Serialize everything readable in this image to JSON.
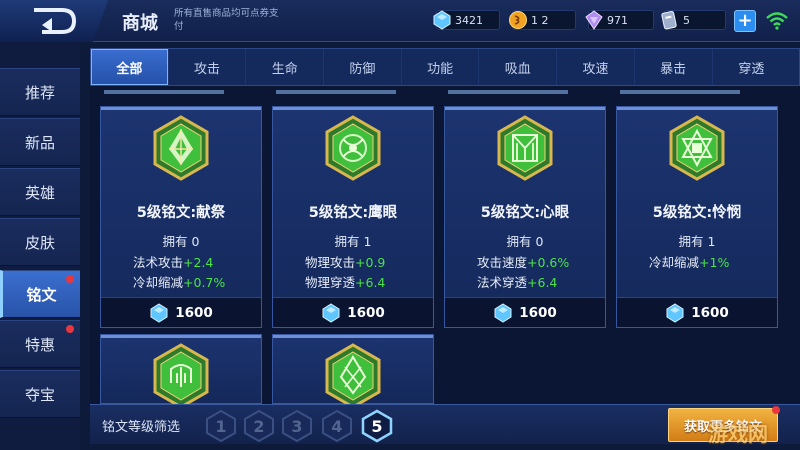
{
  "header": {
    "title": "商城",
    "subtitle": "所有直售商品均可点券支付",
    "currencies": [
      {
        "name": "diamond",
        "icon": "diamond-icon",
        "value": "3421"
      },
      {
        "name": "gold",
        "icon": "gold-coin-icon",
        "value": "1 2"
      },
      {
        "name": "crystal",
        "icon": "crystal-icon",
        "value": "971"
      },
      {
        "name": "voucher",
        "icon": "voucher-icon",
        "value": "5"
      }
    ]
  },
  "sidebar": {
    "items": [
      {
        "label": "推荐",
        "badge": false
      },
      {
        "label": "新品",
        "badge": false
      },
      {
        "label": "英雄",
        "badge": false
      },
      {
        "label": "皮肤",
        "badge": false
      },
      {
        "label": "铭文",
        "badge": true,
        "active": true
      },
      {
        "label": "特惠",
        "badge": true
      },
      {
        "label": "夺宝",
        "badge": false
      }
    ]
  },
  "tabs": [
    {
      "label": "全部",
      "active": true
    },
    {
      "label": "攻击"
    },
    {
      "label": "生命"
    },
    {
      "label": "防御"
    },
    {
      "label": "功能"
    },
    {
      "label": "吸血"
    },
    {
      "label": "攻速"
    },
    {
      "label": "暴击"
    },
    {
      "label": "穿透"
    }
  ],
  "cards": [
    {
      "name": "5级铭文:献祭",
      "owned": "拥有 0",
      "stats": [
        {
          "label": "法术攻击",
          "value": "+2.4"
        },
        {
          "label": "冷却缩减",
          "value": "+0.7%"
        }
      ],
      "price": "1600",
      "emblem": "sacrifice-emblem-icon"
    },
    {
      "name": "5级铭文:鹰眼",
      "owned": "拥有 1",
      "stats": [
        {
          "label": "物理攻击",
          "value": "+0.9"
        },
        {
          "label": "物理穿透",
          "value": "+6.4"
        }
      ],
      "price": "1600",
      "emblem": "hawkeye-emblem-icon"
    },
    {
      "name": "5级铭文:心眼",
      "owned": "拥有 0",
      "stats": [
        {
          "label": "攻击速度",
          "value": "+0.6%"
        },
        {
          "label": "法术穿透",
          "value": "+6.4"
        }
      ],
      "price": "1600",
      "emblem": "mind-eye-emblem-icon"
    },
    {
      "name": "5级铭文:怜悯",
      "owned": "拥有 1",
      "stats": [
        {
          "label": "冷却缩减",
          "value": "+1%"
        }
      ],
      "price": "1600",
      "emblem": "mercy-emblem-icon"
    }
  ],
  "bottom": {
    "filter_label": "铭文等级筛选",
    "levels": [
      "1",
      "2",
      "3",
      "4",
      "5"
    ],
    "selected_level": "5",
    "get_more": "获取更多铭文"
  },
  "watermark": "游戏网",
  "colors": {
    "accent": "#3a6ed0",
    "stat_green": "#4ce24a",
    "badge_red": "#e8383e",
    "emblem_gold": "#c9a94a",
    "emblem_green": "#3dbf3a"
  }
}
